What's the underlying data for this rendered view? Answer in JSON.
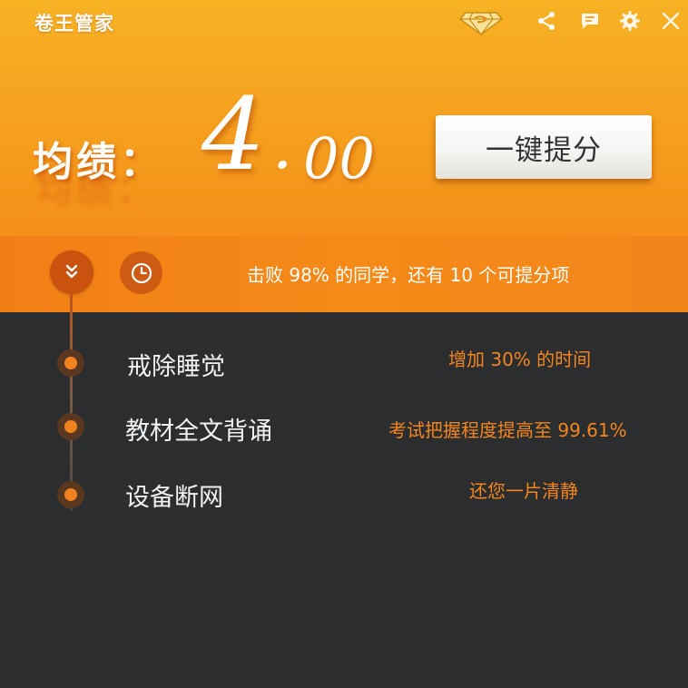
{
  "app": {
    "title": "卷王管家"
  },
  "titlebar": {
    "icons": [
      "diamond-icon",
      "share-icon",
      "message-icon",
      "gear-icon",
      "close-icon"
    ]
  },
  "score": {
    "label": "均绩：",
    "integer": "4",
    "dot": ".",
    "decimal": "00"
  },
  "boost_button": {
    "label": "一键提分"
  },
  "status": {
    "text": "击败 98% 的同学，还有 10 个可提分项"
  },
  "items": [
    {
      "label": "戒除睡觉",
      "effect": "增加 30% 的时间"
    },
    {
      "label": "教材全文背诵",
      "effect": "考试把握程度提高至 99.61%"
    },
    {
      "label": "设备断网",
      "effect": "还您一片清静"
    }
  ],
  "colors": {
    "accent_orange": "#f58a18",
    "dark_bg": "#2c2d2f",
    "effect_text": "#f4861f",
    "button_text": "#333333"
  }
}
